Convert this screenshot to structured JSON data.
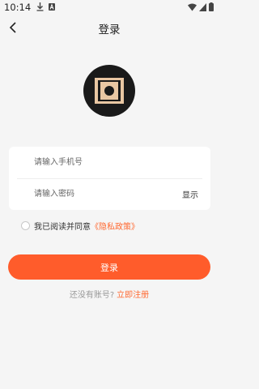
{
  "status_bar": {
    "time": "10:14",
    "icons": [
      "download-icon",
      "a-notification-icon",
      "wifi-icon",
      "signal-icon",
      "battery-icon"
    ]
  },
  "nav": {
    "title": "登录",
    "back_icon": "back-arrow-icon"
  },
  "logo": {
    "icon": "app-logo",
    "colors": {
      "circle": "#1a1a1a",
      "frame": "#e9c7a3"
    }
  },
  "form": {
    "phone_placeholder": "请输入手机号",
    "phone_value": "",
    "password_placeholder": "请输入密码",
    "password_value": "",
    "show_label": "显示"
  },
  "agreement": {
    "checked": false,
    "text": "我已阅读并同意",
    "link": "《隐私政策》"
  },
  "login_button": {
    "label": "登录"
  },
  "register": {
    "prompt": "还没有账号?",
    "link": "立即注册"
  },
  "colors": {
    "accent": "#ff5c2b",
    "link": "#ff6a33",
    "background": "#f5f5f5"
  }
}
